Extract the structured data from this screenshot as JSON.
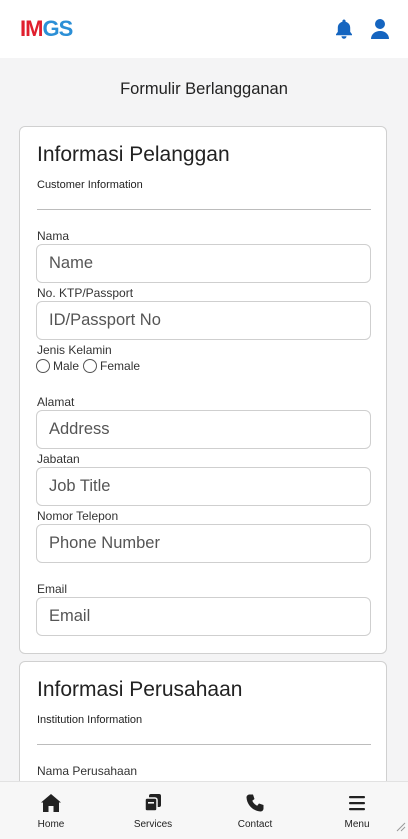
{
  "header": {
    "logo_part1": "IM",
    "logo_part2": "GS",
    "logo_colors": {
      "part1": "#e01f2d",
      "part2": "#2b8fd6"
    },
    "icons": [
      "bell-icon",
      "user-icon"
    ],
    "accent_color": "#1565c0"
  },
  "page": {
    "title": "Formulir Berlangganan"
  },
  "customer_section": {
    "title": "Informasi Pelanggan",
    "subtitle": "Customer Information",
    "fields": {
      "name": {
        "label": "Nama",
        "placeholder": "Name"
      },
      "id": {
        "label": "No. KTP/Passport",
        "placeholder": "ID/Passport No"
      },
      "gender": {
        "label": "Jenis Kelamin",
        "options": [
          "Male",
          "Female"
        ]
      },
      "address": {
        "label": "Alamat",
        "placeholder": "Address"
      },
      "job": {
        "label": "Jabatan",
        "placeholder": "Job Title"
      },
      "phone": {
        "label": "Nomor Telepon",
        "placeholder": "Phone Number"
      },
      "email": {
        "label": "Email",
        "placeholder": "Email"
      }
    }
  },
  "institution_section": {
    "title": "Informasi Perusahaan",
    "subtitle": "Institution Information",
    "fields": {
      "company": {
        "label": "Nama Perusahaan"
      }
    }
  },
  "bottom_nav": [
    {
      "label": "Home",
      "icon": "home-icon"
    },
    {
      "label": "Services",
      "icon": "services-icon"
    },
    {
      "label": "Contact",
      "icon": "phone-icon"
    },
    {
      "label": "Menu",
      "icon": "menu-icon"
    }
  ]
}
